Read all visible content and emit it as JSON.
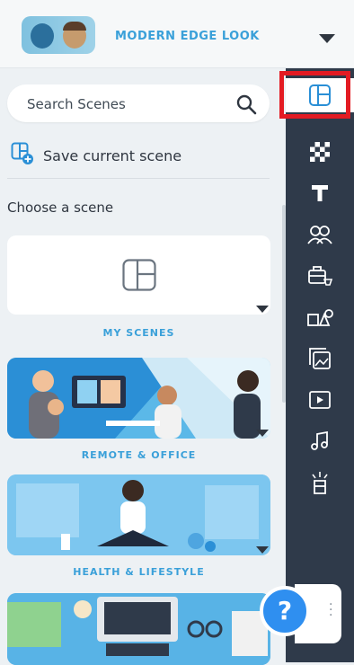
{
  "header": {
    "title": "MODERN EDGE LOOK",
    "avatar_icon": "character-avatars-icon",
    "dropdown_icon": "caret-down-icon"
  },
  "search": {
    "placeholder": "Search Scenes",
    "icon": "search-icon"
  },
  "save_scene": {
    "label": "Save current scene",
    "icon": "add-scene-icon"
  },
  "choose_label": "Choose a scene",
  "scene_cards": [
    {
      "label": "MY SCENES"
    },
    {
      "label": "REMOTE & OFFICE"
    },
    {
      "label": "HEALTH & LIFESTYLE"
    },
    {
      "label": ""
    }
  ],
  "rail": {
    "items": [
      {
        "name": "scenes-icon",
        "active": true
      },
      {
        "name": "background-icon",
        "active": false
      },
      {
        "name": "text-icon",
        "active": false
      },
      {
        "name": "characters-icon",
        "active": false
      },
      {
        "name": "props-icon",
        "active": false
      },
      {
        "name": "shapes-icon",
        "active": false
      },
      {
        "name": "images-icon",
        "active": false
      },
      {
        "name": "video-icon",
        "active": false
      },
      {
        "name": "music-icon",
        "active": false
      },
      {
        "name": "effects-icon",
        "active": false
      }
    ]
  },
  "help": {
    "label": "?"
  },
  "colors": {
    "accent": "#3aa0d9",
    "rail_bg": "#2f3a4a",
    "highlight": "#e31b23",
    "help_button": "#2f8ff0"
  }
}
